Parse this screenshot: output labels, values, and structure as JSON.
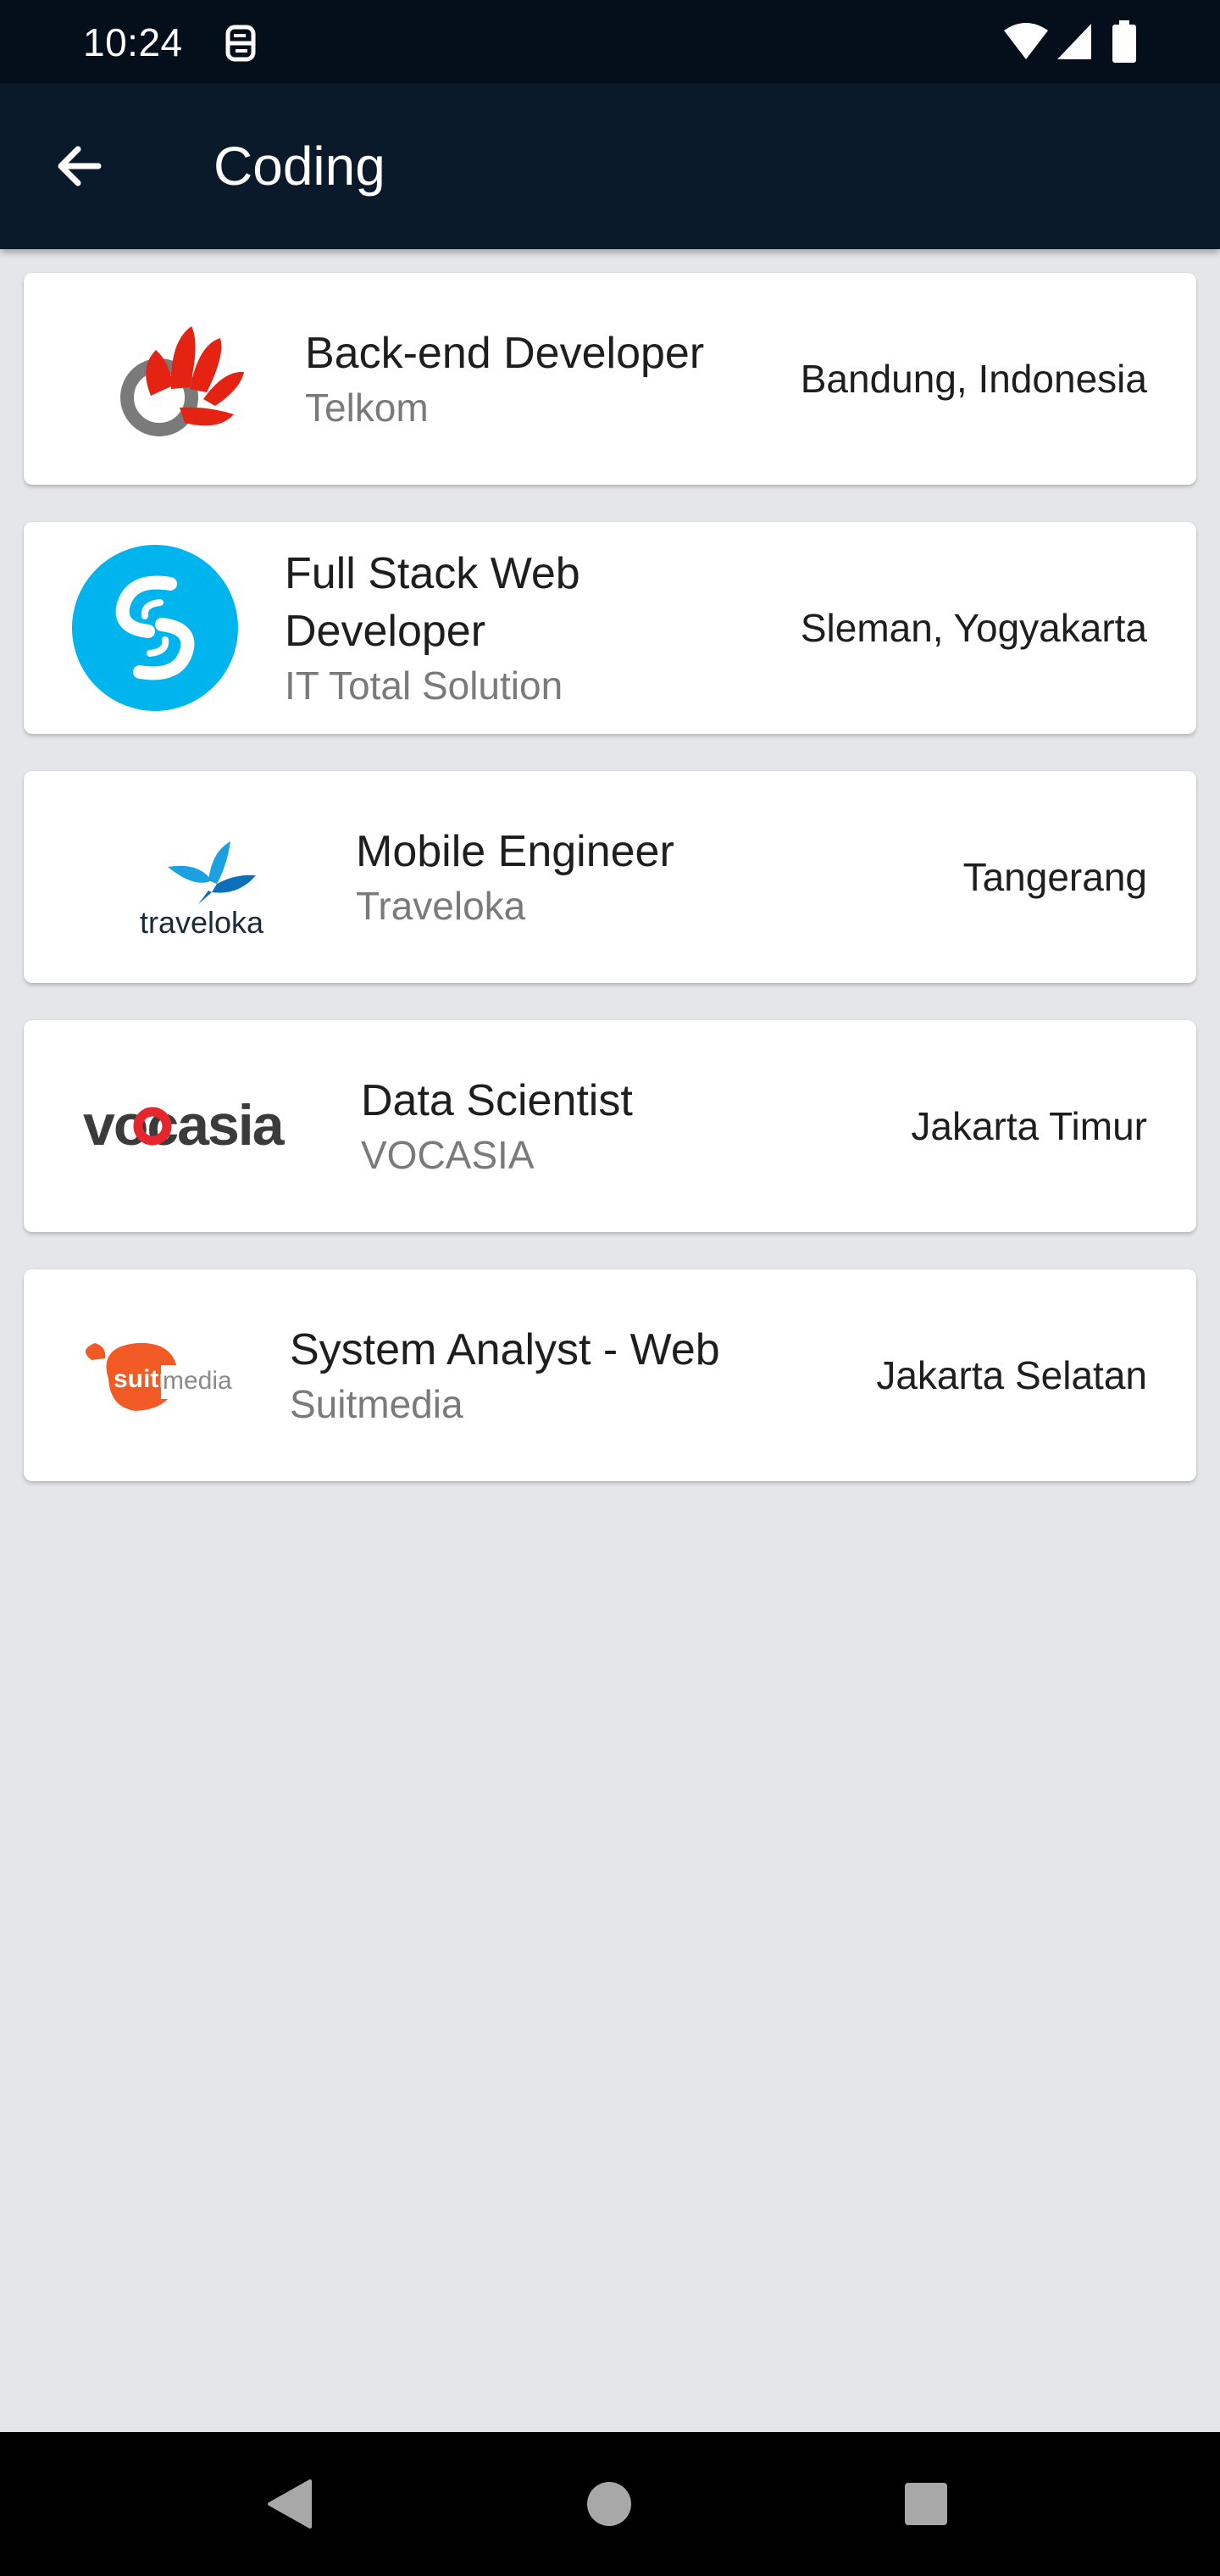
{
  "status_bar": {
    "time": "10:24",
    "icons": [
      "notification-icon",
      "wifi-icon",
      "signal-icon",
      "battery-icon"
    ]
  },
  "app_bar": {
    "title": "Coding",
    "back_icon": "arrow-back-icon"
  },
  "jobs": [
    {
      "title": "Back-end Developer",
      "company": "Telkom",
      "location": "Bandung, Indonesia",
      "logo": "telkom-logo"
    },
    {
      "title": "Full Stack Web Developer",
      "company": "IT Total Solution",
      "location": "Sleman, Yogyakarta",
      "logo": "it-total-solution-logo"
    },
    {
      "title": "Mobile Engineer",
      "company": "Traveloka",
      "location": "Tangerang",
      "logo": "traveloka-logo",
      "logo_text": "traveloka"
    },
    {
      "title": "Data Scientist",
      "company": "VOCASIA",
      "location": "Jakarta Timur",
      "logo": "vocasia-logo",
      "logo_text": "vocasia"
    },
    {
      "title": "System Analyst - Web",
      "company": "Suitmedia",
      "location": "Jakarta Selatan",
      "logo": "suitmedia-logo",
      "logo_text": "suitmedia"
    }
  ],
  "nav_bar": {
    "buttons": [
      "back-triangle-icon",
      "home-circle-icon",
      "recents-square-icon"
    ]
  },
  "colors": {
    "status_bar": "#050f1b",
    "app_bar": "#0b1a2b",
    "background": "#e5e6ea",
    "telkom_red": "#e42313",
    "itts_blue": "#00b4ee",
    "traveloka_blue": "#1ba0e2",
    "vocasia_red": "#e5262d",
    "suitmedia_orange": "#f15a24"
  }
}
